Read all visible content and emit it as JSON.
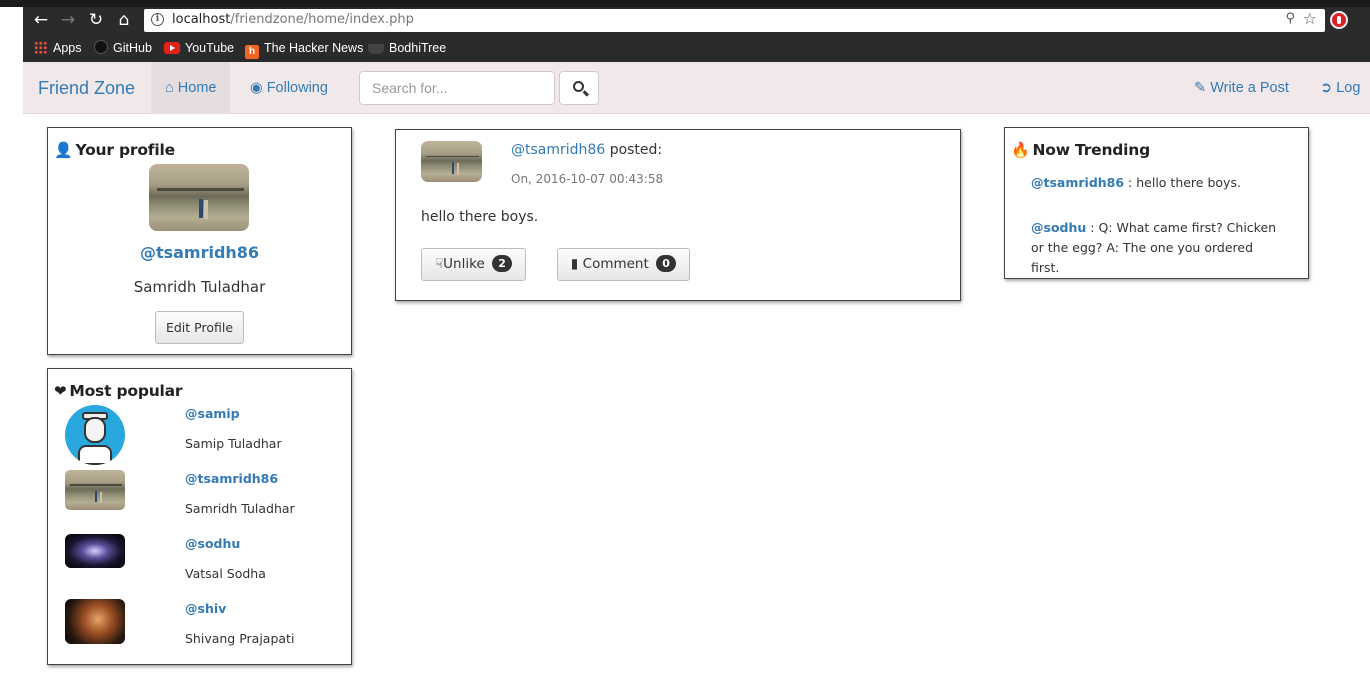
{
  "browser": {
    "url_host": "localhost",
    "url_path": "/friendzone/home/index.php",
    "bookmarks": [
      "Apps",
      "GitHub",
      "YouTube",
      "The Hacker News",
      "BodhiTree"
    ]
  },
  "navbar": {
    "brand": "Friend Zone",
    "home": "Home",
    "following": "Following",
    "search_placeholder": "Search for...",
    "write_post": "Write a Post",
    "logout": "Log"
  },
  "profile": {
    "title": "Your profile",
    "handle": "@tsamridh86",
    "name": "Samridh Tuladhar",
    "edit_button": "Edit Profile"
  },
  "popular": {
    "title": "Most popular",
    "users": [
      {
        "handle": "@samip",
        "name": "Samip Tuladhar"
      },
      {
        "handle": "@tsamridh86",
        "name": "Samridh Tuladhar"
      },
      {
        "handle": "@sodhu",
        "name": "Vatsal Sodha"
      },
      {
        "handle": "@shiv",
        "name": "Shivang Prajapati"
      }
    ]
  },
  "post": {
    "author": "@tsamridh86",
    "posted_label": "posted:",
    "timestamp": "On, 2016-10-07 00:43:58",
    "body": "hello there boys.",
    "unlike_label": "Unlike",
    "unlike_count": "2",
    "comment_label": "Comment",
    "comment_count": "0"
  },
  "trending": {
    "title": "Now Trending",
    "items": [
      {
        "handle": "@tsamridh86",
        "text": " : hello there boys."
      },
      {
        "handle": "@sodhu",
        "text": " : Q: What came first? Chicken or the egg? A: The one you ordered first."
      }
    ]
  },
  "colors": {
    "link": "#337ab7",
    "navbar_bg": "#f1e9e9",
    "chrome_bg": "#2b2b2b"
  }
}
